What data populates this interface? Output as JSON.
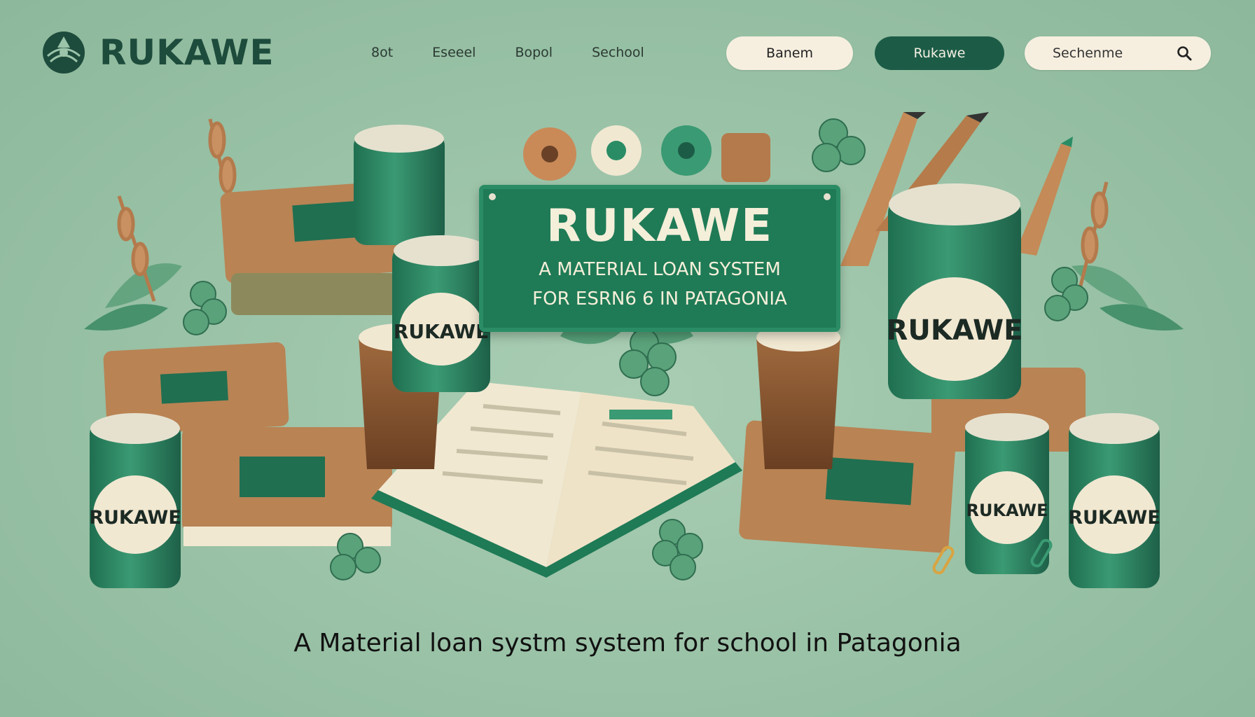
{
  "brand": {
    "name": "RUKAWE"
  },
  "nav": {
    "links": [
      "8ot",
      "Eseeel",
      "Bopol",
      "Sechool"
    ]
  },
  "header": {
    "button_light": "Banem",
    "button_dark": "Rukawe",
    "search_text": "Sechenme"
  },
  "hero": {
    "sign_title": "RUKAWE",
    "sign_line1": "A MATERIAL LOAN SYSTEM",
    "sign_line2": "FOR ESRN6 6 IN PATAGONIA",
    "can_label": "RUKAWE",
    "tagline": "A Material loan systm system for school in Patagonia"
  },
  "colors": {
    "background": "#97c0a4",
    "brand_dark": "#1c5c47",
    "sign_green": "#1f7a56",
    "cream": "#f6efe0",
    "book_brown": "#b98354"
  },
  "icons": {
    "logo": "leaf-emblem-icon",
    "search": "search-icon"
  }
}
